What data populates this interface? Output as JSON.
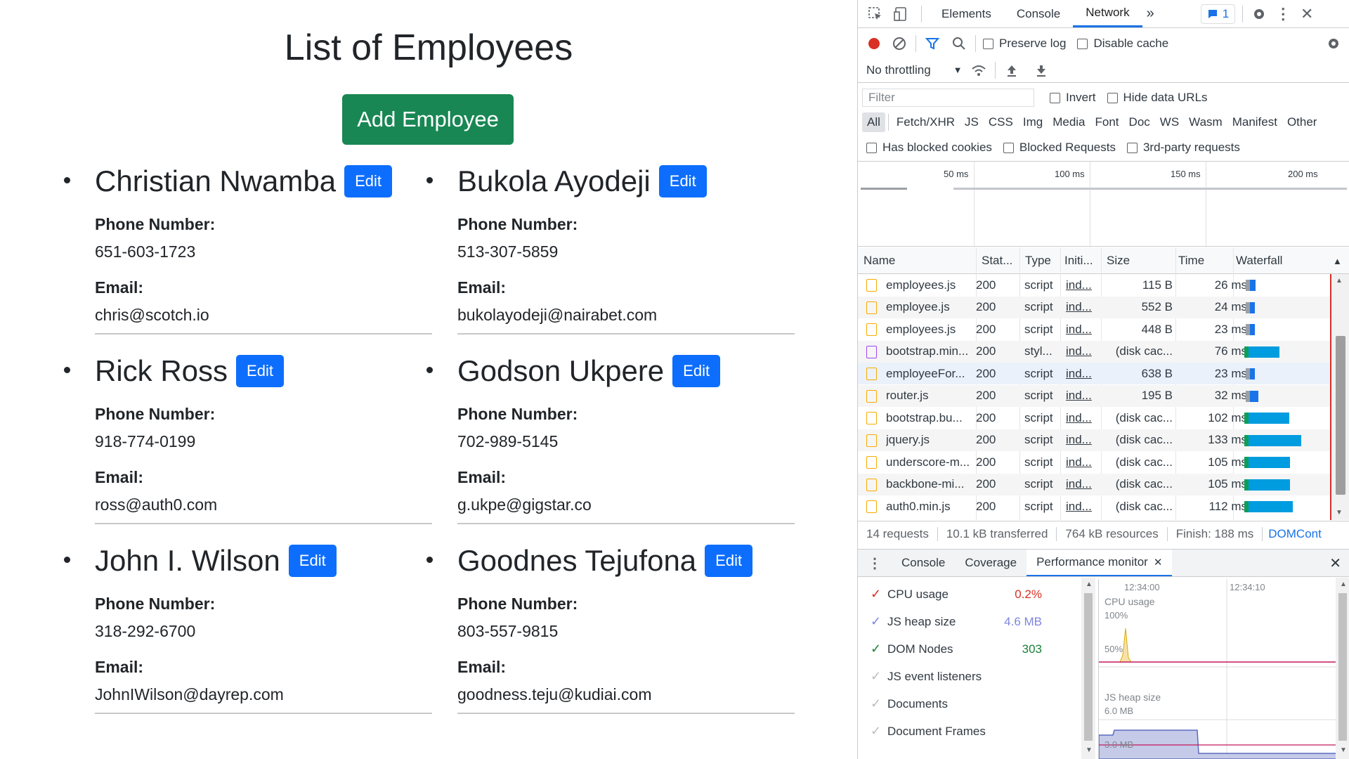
{
  "app": {
    "title": "List of Employees",
    "add_button": "Add Employee",
    "phone_label": "Phone Number:",
    "email_label": "Email:",
    "edit_label": "Edit",
    "employees_left": [
      {
        "name": "Christian Nwamba",
        "phone": "651-603-1723",
        "email": "chris@scotch.io"
      },
      {
        "name": "Rick Ross",
        "phone": "918-774-0199",
        "email": "ross@auth0.com"
      },
      {
        "name": "John I. Wilson",
        "phone": "318-292-6700",
        "email": "JohnIWilson@dayrep.com"
      }
    ],
    "employees_right": [
      {
        "name": "Bukola Ayodeji",
        "phone": "513-307-5859",
        "email": "bukolayodeji@nairabet.com"
      },
      {
        "name": "Godson Ukpere",
        "phone": "702-989-5145",
        "email": "g.ukpe@gigstar.co"
      },
      {
        "name": "Goodnes Tejufona",
        "phone": "803-557-9815",
        "email": "goodness.teju@kudiai.com"
      }
    ]
  },
  "devtools": {
    "tabs": [
      "Elements",
      "Console",
      "Network"
    ],
    "active_tab": "Network",
    "more_tabs": "»",
    "issues_count": "1",
    "toolbar": {
      "preserve_log": "Preserve log",
      "disable_cache": "Disable cache",
      "throttling": "No throttling"
    },
    "filter": {
      "placeholder": "Filter",
      "invert": "Invert",
      "hide_data_urls": "Hide data URLs",
      "types": [
        "All",
        "Fetch/XHR",
        "JS",
        "CSS",
        "Img",
        "Media",
        "Font",
        "Doc",
        "WS",
        "Wasm",
        "Manifest",
        "Other"
      ],
      "has_blocked_cookies": "Has blocked cookies",
      "blocked_requests": "Blocked Requests",
      "third_party": "3rd-party requests"
    },
    "timeline_ticks": [
      "50 ms",
      "100 ms",
      "150 ms",
      "200 ms"
    ],
    "columns": {
      "name": "Name",
      "status": "Stat...",
      "type": "Type",
      "initiator": "Initi...",
      "size": "Size",
      "time": "Time",
      "waterfall": "Waterfall"
    },
    "requests": [
      {
        "name": "employees.js",
        "status": "200",
        "type": "script",
        "initiator": "ind...",
        "size": "115 B",
        "time": "26 ms",
        "kind": "js",
        "wf_start": 0.14,
        "wf_len": 0.06,
        "wf_color": "#1a73e8"
      },
      {
        "name": "employee.js",
        "status": "200",
        "type": "script",
        "initiator": "ind...",
        "size": "552 B",
        "time": "24 ms",
        "kind": "js",
        "wf_start": 0.14,
        "wf_len": 0.05,
        "wf_color": "#1a73e8"
      },
      {
        "name": "employees.js",
        "status": "200",
        "type": "script",
        "initiator": "ind...",
        "size": "448 B",
        "time": "23 ms",
        "kind": "js",
        "wf_start": 0.14,
        "wf_len": 0.05,
        "wf_color": "#1a73e8"
      },
      {
        "name": "bootstrap.min...",
        "status": "200",
        "type": "styl...",
        "initiator": "ind...",
        "size": "(disk cac...",
        "time": "76 ms",
        "kind": "css",
        "wf_start": 0.12,
        "wf_len": 0.34,
        "wf_color": "#009ce0"
      },
      {
        "name": "employeeFor...",
        "status": "200",
        "type": "script",
        "initiator": "ind...",
        "size": "638 B",
        "time": "23 ms",
        "kind": "js",
        "wf_start": 0.14,
        "wf_len": 0.05,
        "wf_color": "#1a73e8"
      },
      {
        "name": "router.js",
        "status": "200",
        "type": "script",
        "initiator": "ind...",
        "size": "195 B",
        "time": "32 ms",
        "kind": "js",
        "wf_start": 0.14,
        "wf_len": 0.09,
        "wf_color": "#1a73e8"
      },
      {
        "name": "bootstrap.bu...",
        "status": "200",
        "type": "script",
        "initiator": "ind...",
        "size": "(disk cac...",
        "time": "102 ms",
        "kind": "js",
        "wf_start": 0.12,
        "wf_len": 0.45,
        "wf_color": "#009ce0"
      },
      {
        "name": "jquery.js",
        "status": "200",
        "type": "script",
        "initiator": "ind...",
        "size": "(disk cac...",
        "time": "133 ms",
        "kind": "js",
        "wf_start": 0.12,
        "wf_len": 0.58,
        "wf_color": "#009ce0"
      },
      {
        "name": "underscore-m...",
        "status": "200",
        "type": "script",
        "initiator": "ind...",
        "size": "(disk cac...",
        "time": "105 ms",
        "kind": "js",
        "wf_start": 0.12,
        "wf_len": 0.46,
        "wf_color": "#009ce0"
      },
      {
        "name": "backbone-mi...",
        "status": "200",
        "type": "script",
        "initiator": "ind...",
        "size": "(disk cac...",
        "time": "105 ms",
        "kind": "js",
        "wf_start": 0.12,
        "wf_len": 0.46,
        "wf_color": "#009ce0"
      },
      {
        "name": "auth0.min.js",
        "status": "200",
        "type": "script",
        "initiator": "ind...",
        "size": "(disk cac...",
        "time": "112 ms",
        "kind": "js",
        "wf_start": 0.12,
        "wf_len": 0.49,
        "wf_color": "#009ce0"
      }
    ],
    "summary": {
      "requests": "14 requests",
      "transferred": "10.1 kB transferred",
      "resources": "764 kB resources",
      "finish": "Finish: 188 ms",
      "domcont": "DOMCont"
    },
    "drawer": {
      "tabs": [
        "Console",
        "Coverage",
        "Performance monitor"
      ],
      "active": "Performance monitor"
    },
    "perf": {
      "metrics": [
        {
          "label": "CPU usage",
          "value": "0.2%",
          "color": "#d93025",
          "checked": true
        },
        {
          "label": "JS heap size",
          "value": "4.6 MB",
          "color": "#7e86e0",
          "checked": true
        },
        {
          "label": "DOM Nodes",
          "value": "303",
          "color": "#188038",
          "checked": true
        },
        {
          "label": "JS event listeners",
          "value": "",
          "color": "#bdbdbd",
          "checked": false
        },
        {
          "label": "Documents",
          "value": "",
          "color": "#bdbdbd",
          "checked": false
        },
        {
          "label": "Document Frames",
          "value": "",
          "color": "#bdbdbd",
          "checked": false
        }
      ],
      "times": [
        "12:34:00",
        "12:34:10"
      ],
      "cpu_label": "CPU usage",
      "cpu_100": "100%",
      "cpu_50": "50%",
      "heap_label": "JS heap size",
      "heap_6": "6.0 MB",
      "heap_3": "3.0 MB"
    }
  }
}
